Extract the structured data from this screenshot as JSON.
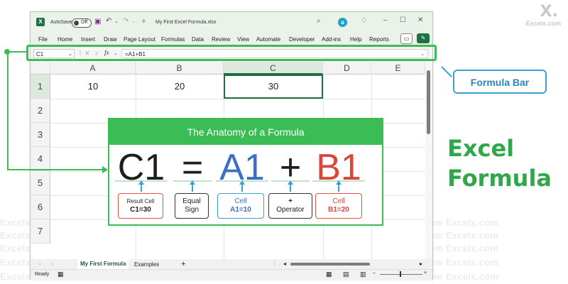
{
  "watermark": {
    "site": "Excelx.com",
    "logo": "X."
  },
  "window": {
    "autosave_label": "AutoSave",
    "autosave_state": "Off",
    "file_title": "My First Excel Formula.xlsx",
    "user_initial": "a"
  },
  "menu": [
    "File",
    "Home",
    "Insert",
    "Draw",
    "Page Layout",
    "Formulas",
    "Data",
    "Review",
    "View",
    "Automate",
    "Developer",
    "Add-ins",
    "Help",
    "Reports"
  ],
  "formula_bar": {
    "name_box": "C1",
    "fx": "fx",
    "formula": "=A1+B1"
  },
  "grid": {
    "columns": [
      "A",
      "B",
      "C",
      "D",
      "E"
    ],
    "rows": [
      "1",
      "2",
      "3",
      "4",
      "5",
      "6",
      "7"
    ],
    "cells": {
      "A1": "10",
      "B1": "20",
      "C1": "30"
    },
    "selected_column": "C",
    "selected_row": "1"
  },
  "sheet_tabs": {
    "tabs": [
      "My First Formula",
      "Examples"
    ],
    "active": "My First Formula",
    "add": "+"
  },
  "status": {
    "ready": "Ready"
  },
  "anatomy": {
    "title": "The Anatomy of a Formula",
    "parts": [
      {
        "symbol": "C1",
        "color": "#1e1e1e",
        "label_line1": "Result Cell",
        "label_line2": "C1=30",
        "border": "#e2533e"
      },
      {
        "symbol": "=",
        "color": "#1e1e1e",
        "label_line1": "Equal",
        "label_line2": "Sign",
        "border": "#333333"
      },
      {
        "symbol": "A1",
        "color": "#3a6fc4",
        "label_line1": "Cell",
        "label_line2": "A1=10",
        "border": "#3ba0d4"
      },
      {
        "symbol": "+",
        "color": "#1e1e1e",
        "label_line1": "+",
        "label_line2": "Operator",
        "border": "#333333"
      },
      {
        "symbol": "B1",
        "color": "#d9473a",
        "label_line1": "Cell",
        "label_line2": "B1=20",
        "border": "#e2533e"
      }
    ]
  },
  "callouts": {
    "formula_bar_label": "Formula Bar",
    "excel_line1": "Excel",
    "excel_line2": "Formula"
  },
  "colors": {
    "accent_green": "#3cbc55",
    "excel_green": "#1d7044",
    "callout_blue": "#3ba0d4"
  }
}
